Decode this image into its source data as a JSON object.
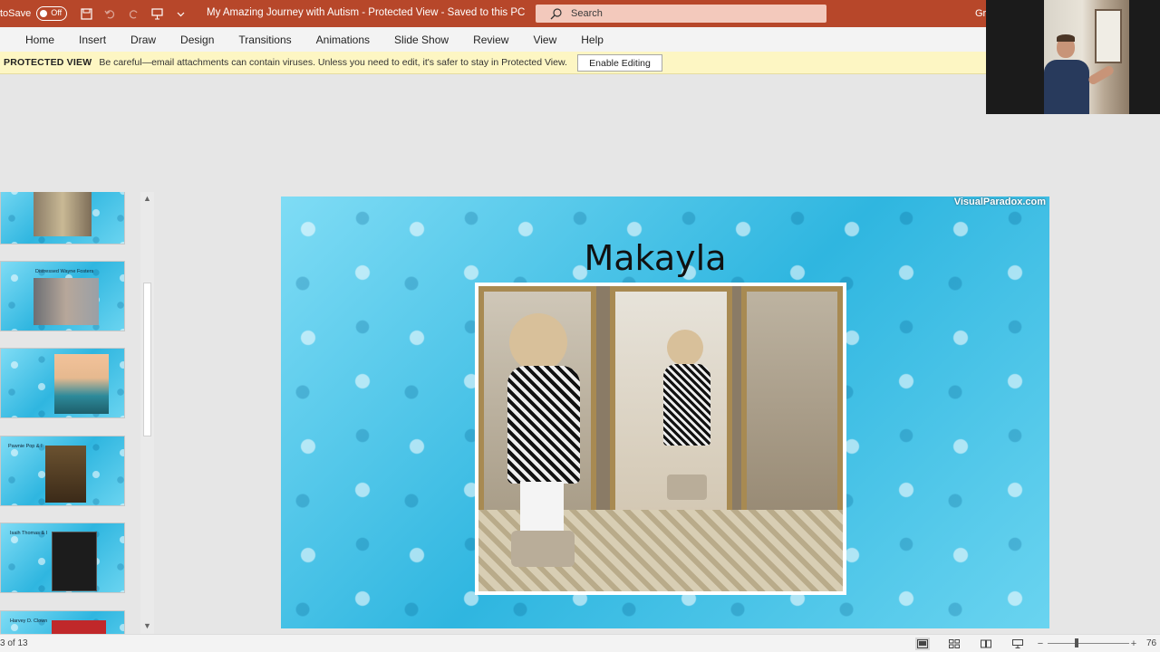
{
  "titlebar": {
    "autosave_label": "toSave",
    "autosave_state": "Off",
    "doc_title": "My Amazing Journey with Autism  -  Protected View  -  Saved to this PC",
    "search_placeholder": "Search",
    "user_initials": "Gr"
  },
  "ribbon": {
    "tabs": [
      "Home",
      "Insert",
      "Draw",
      "Design",
      "Transitions",
      "Animations",
      "Slide Show",
      "Review",
      "View",
      "Help"
    ]
  },
  "protected_view": {
    "title": "PROTECTED VIEW",
    "message": "Be careful—email attachments can contain viruses. Unless you need to edit, it's safer to stay in Protected View.",
    "button": "Enable Editing"
  },
  "thumbnails": [
    {
      "caption": ""
    },
    {
      "caption": "Distressed Wayne Fosters"
    },
    {
      "caption": ""
    },
    {
      "caption": "Pawnie Pop & I"
    },
    {
      "caption": "Isaih Thomas & I"
    },
    {
      "caption": "Harvey D. Clown"
    }
  ],
  "slide": {
    "watermark": "VisualParadox.com",
    "title": "Makayla"
  },
  "statusbar": {
    "slide_counter": "3 of 13",
    "zoom": "76"
  },
  "colors": {
    "titlebar": "#b7472a",
    "protected_bar": "#fdf6c3",
    "puzzle_blue": "#3fc2e6"
  }
}
